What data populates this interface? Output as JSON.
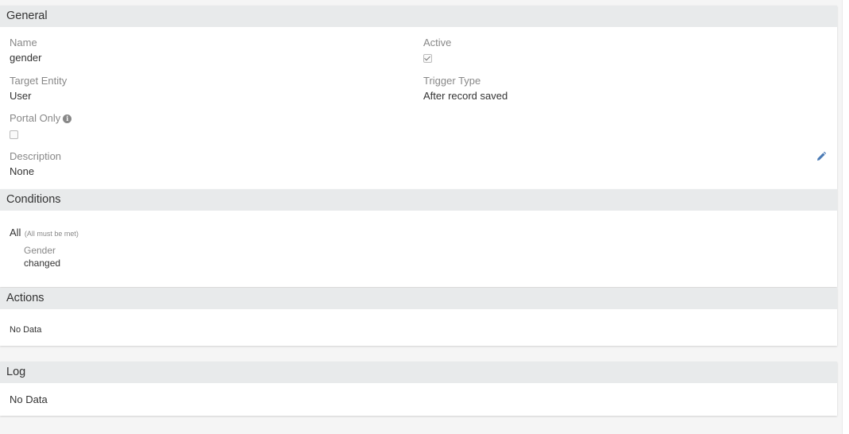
{
  "general": {
    "header": "General",
    "name_label": "Name",
    "name_value": "gender",
    "active_label": "Active",
    "target_entity_label": "Target Entity",
    "target_entity_value": "User",
    "trigger_type_label": "Trigger Type",
    "trigger_type_value": "After record saved",
    "portal_only_label": "Portal Only",
    "portal_only_info_icon": "i",
    "description_label": "Description",
    "description_value": "None"
  },
  "conditions": {
    "header": "Conditions",
    "group_label": "All",
    "group_note": "(All must be met)",
    "items": [
      {
        "field": "Gender",
        "condition": "changed"
      }
    ]
  },
  "actions": {
    "header": "Actions",
    "empty_text": "No Data"
  },
  "log": {
    "header": "Log",
    "empty_text": "No Data"
  },
  "icons": {
    "info": "info-icon",
    "edit": "pencil-icon"
  },
  "colors": {
    "header_bg": "#e8eaeb",
    "label_text": "#888888",
    "edit_icon": "#4a7ab5"
  }
}
